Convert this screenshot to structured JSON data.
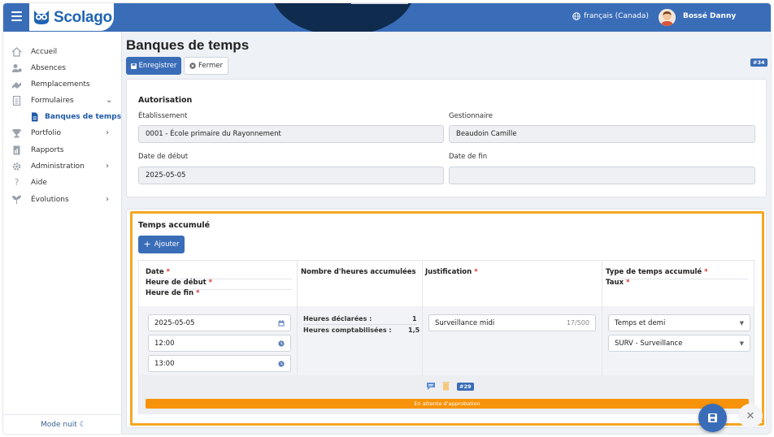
{
  "header": {
    "logo_text": "Scolago",
    "language": "français (Canada)",
    "user_name": "Bossé Danny"
  },
  "sidebar": {
    "items": [
      {
        "label": "Accueil",
        "icon": "home-icon"
      },
      {
        "label": "Absences",
        "icon": "user-absence-icon"
      },
      {
        "label": "Remplacements",
        "icon": "swap-icon"
      },
      {
        "label": "Formulaires",
        "icon": "form-icon",
        "expanded": true
      },
      {
        "label": "Banques de temps",
        "icon": "document-icon",
        "active": true
      },
      {
        "label": "Portfolio",
        "icon": "trophy-icon"
      },
      {
        "label": "Rapports",
        "icon": "report-icon"
      },
      {
        "label": "Administration",
        "icon": "gear-icon"
      },
      {
        "label": "Aide",
        "icon": "help-icon"
      },
      {
        "label": "Évolutions",
        "icon": "evolution-icon"
      }
    ],
    "night_mode_label": "Mode nuit"
  },
  "page": {
    "title": "Banques de temps",
    "save_label": "Enregistrer",
    "close_label": "Fermer",
    "record_badge": "#34"
  },
  "authorization": {
    "section_title": "Autorisation",
    "establishment_label": "Établissement",
    "establishment_value": "0001 - École primaire du Rayonnement",
    "manager_label": "Gestionnaire",
    "manager_value": "Beaudoin Camille",
    "start_date_label": "Date de début",
    "start_date_value": "2025-05-05",
    "end_date_label": "Date de fin",
    "end_date_value": ""
  },
  "accumulated": {
    "section_title": "Temps accumulé",
    "add_label": "Ajouter",
    "columns": {
      "date": "Date",
      "start_time": "Heure de début",
      "end_time": "Heure de fin",
      "hours": "Nombre d'heures accumulées",
      "justification": "Justification",
      "type": "Type de temps accumulé",
      "rate": "Taux"
    },
    "rows": [
      {
        "date": "2025-05-05",
        "start_time": "12:00",
        "end_time": "13:00",
        "declared_label": "Heures déclarées :",
        "declared_value": "1",
        "counted_label": "Heures comptabilisées :",
        "counted_value": "1,5",
        "justification": "Surveillance midi",
        "char_count": "17/500",
        "type": "Temps et demi",
        "rate": "SURV - Surveillance",
        "badge": "#29",
        "status": "En attente d'approbation"
      }
    ]
  },
  "colors": {
    "primary": "#3a6db8",
    "highlight": "#f5a623",
    "status_pending": "#f7930a"
  }
}
